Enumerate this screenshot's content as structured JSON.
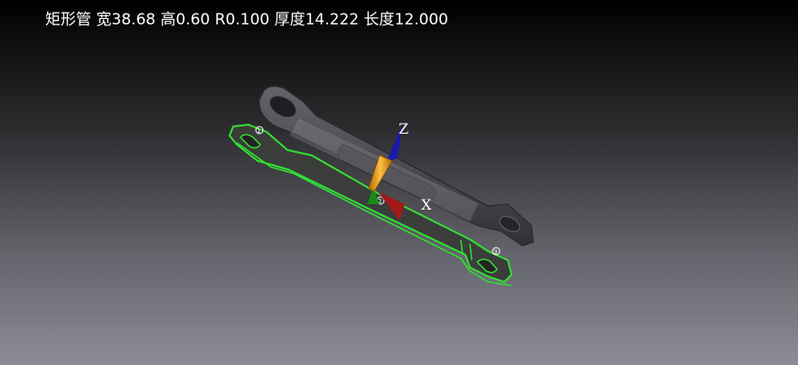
{
  "viewport": {
    "info_text": "矩形管 宽38.68 高0.60 R0.100 厚度14.222 长度12.000"
  },
  "gizmo": {
    "z_label": "Z",
    "x_label": "X",
    "colors": {
      "z": "#1a1aa8",
      "x": "#a01a1a",
      "y": "#1a8a1a",
      "center": "#f0a020"
    }
  },
  "model": {
    "highlight_color": "#33e033",
    "body_color": "#4a4a4e",
    "hole_markers": [
      "1",
      "2",
      "3"
    ]
  }
}
